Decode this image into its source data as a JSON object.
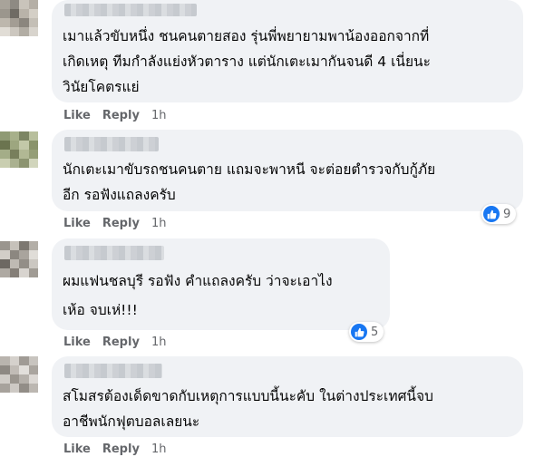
{
  "comments": [
    {
      "text": "เมาแล้วขับหนึ่ง ชนคนตายสอง รุ่นพี่พยายามพาน้องออกจากที่\nเกิดเหตุ ทีมกำลังแย่งหัวตาราง แต่นักเตะเมากันจนดี 4 เนี่ยนะ\nวินัยโคตรแย่",
      "actions": {
        "like": "Like",
        "reply": "Reply",
        "time": "1h"
      }
    },
    {
      "text": "นักเตะเมาขับรถชนคนตาย แถมจะพาหนี จะต่อยตำรวจกับกู้ภัย\nอีก รอฟังแถลงครับ",
      "actions": {
        "like": "Like",
        "reply": "Reply",
        "time": "1h"
      },
      "reaction_count": "9"
    },
    {
      "text": "ผมแฟนชลบุรี รอฟัง คำแถลงครับ ว่าจะเอาไง\nเห้อ จบเห่!!!",
      "actions": {
        "like": "Like",
        "reply": "Reply",
        "time": "1h"
      },
      "reaction_count": "5"
    },
    {
      "text": "สโมสรต้องเด็ดขาดกับเหตุการแบบนี้นะคับ ในต่างประเทศนี้จบ\nอาชีพนักฟุตบอลเลยนะ",
      "actions": {
        "like": "Like",
        "reply": "Reply",
        "time": "1h"
      }
    }
  ],
  "icons": {
    "reaction": "thumbs-up-icon"
  },
  "colors": {
    "bubble": "#f0f2f5",
    "meta": "#65676b",
    "like_blue": "#1877f2"
  }
}
